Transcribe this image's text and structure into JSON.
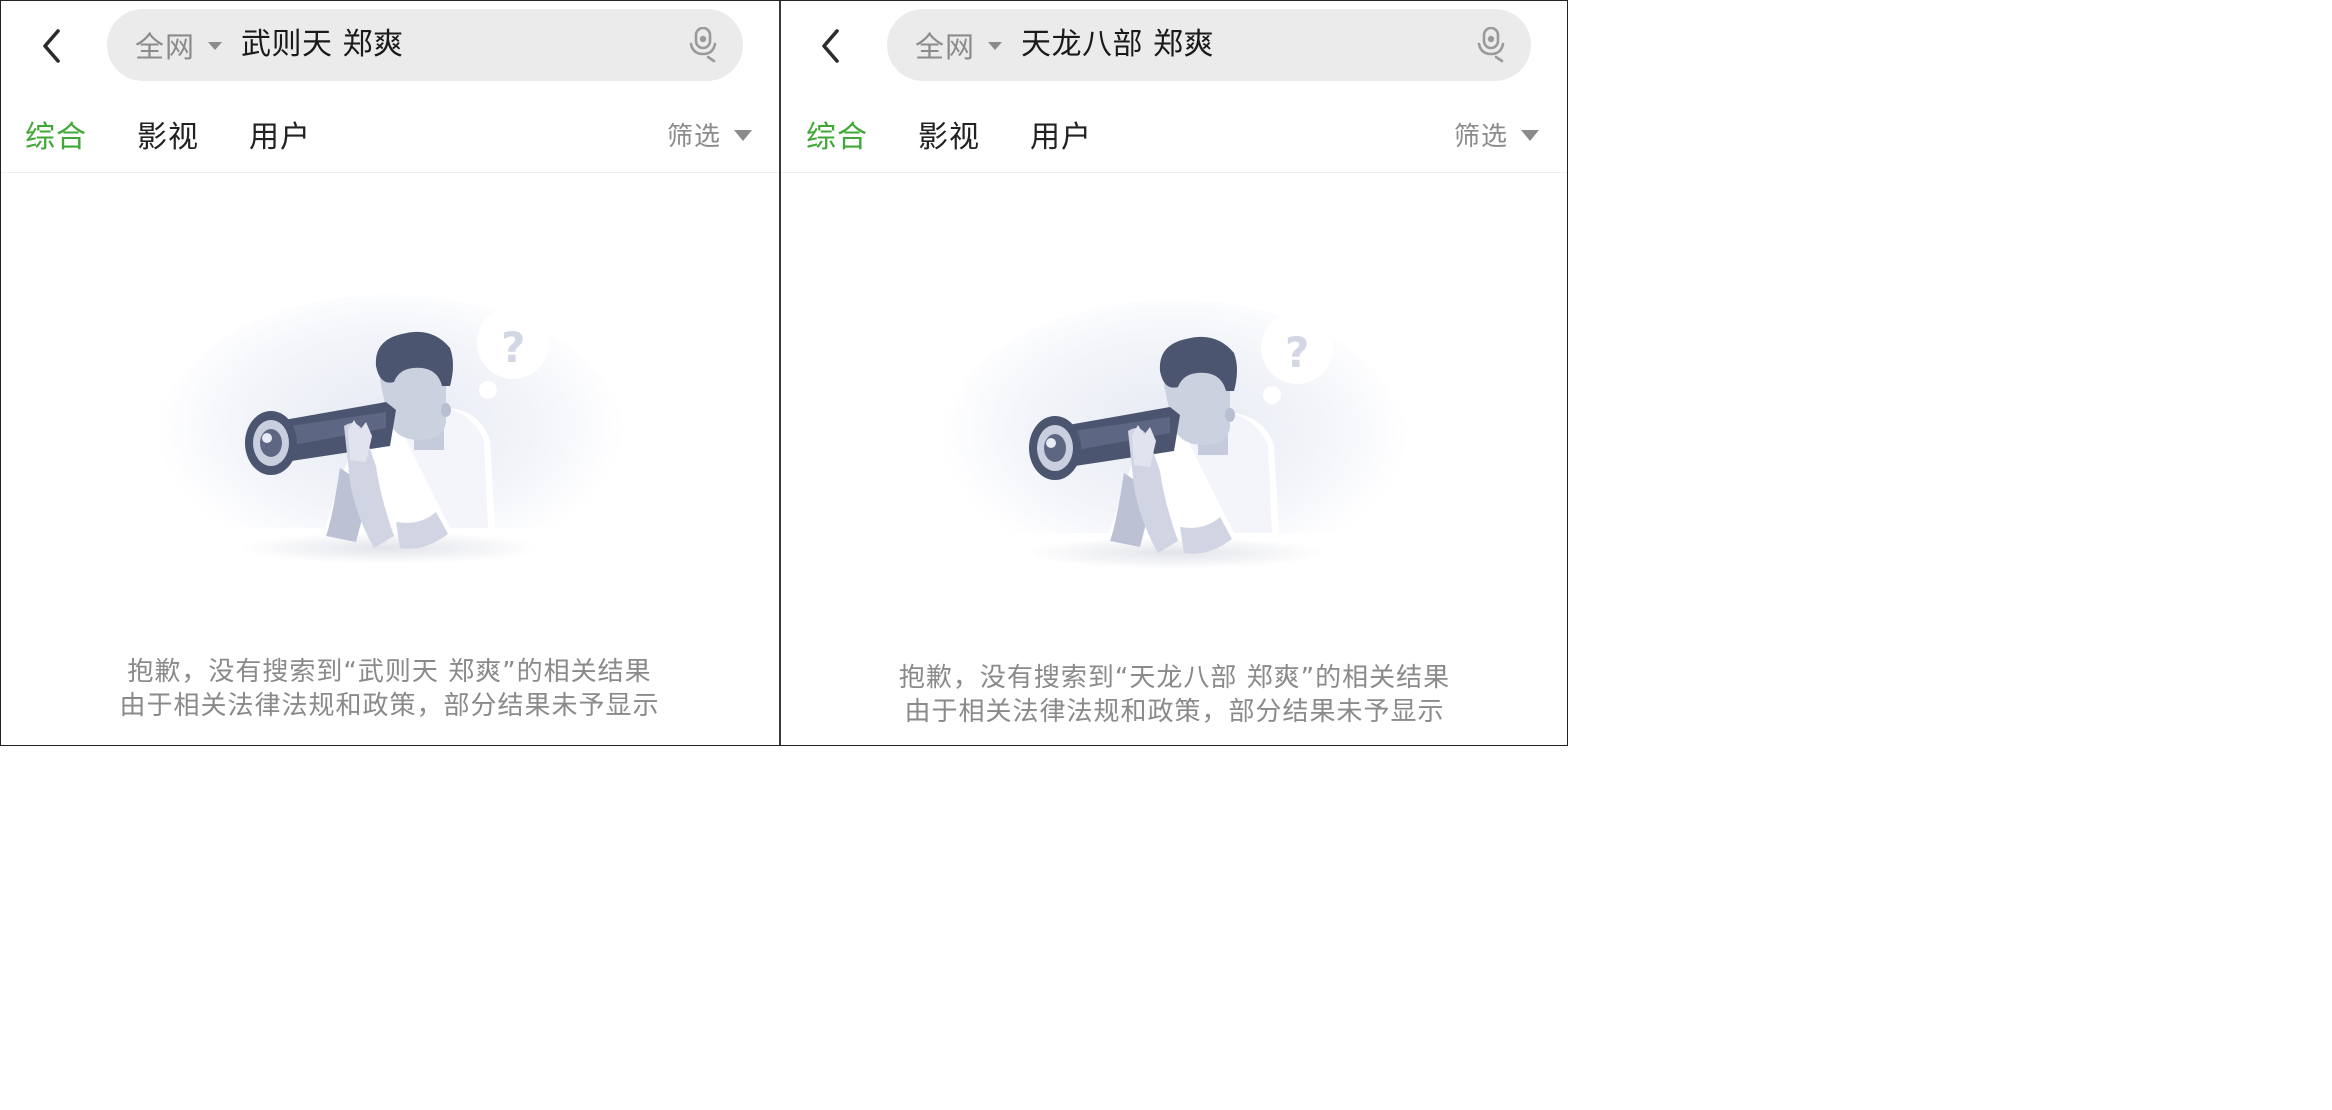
{
  "colors": {
    "accent_green": "#3fa835",
    "search_bg": "#ebebeb",
    "muted_text": "#8a8a8a",
    "illustration_navy": "#4b5570"
  },
  "panels": [
    {
      "search": {
        "scope": "全网",
        "query": "武则天 郑爽",
        "scope_icon": "caret-down-icon",
        "voice_icon": "microphone-icon"
      },
      "tabs": [
        {
          "label": "综合",
          "active": true
        },
        {
          "label": "影视"
        },
        {
          "label": "用户"
        }
      ],
      "filter": {
        "label": "筛选",
        "icon": "caret-down-icon"
      },
      "empty_state": {
        "icon": "telescope-search-illustration",
        "line1": "抱歉，没有搜索到“武则天 郑爽”的相关结果",
        "line2": "由于相关法律法规和政策，部分结果未予显示"
      }
    },
    {
      "search": {
        "scope": "全网",
        "query": "天龙八部 郑爽",
        "scope_icon": "caret-down-icon",
        "voice_icon": "microphone-icon"
      },
      "tabs": [
        {
          "label": "综合",
          "active": true
        },
        {
          "label": "影视"
        },
        {
          "label": "用户"
        }
      ],
      "filter": {
        "label": "筛选",
        "icon": "caret-down-icon"
      },
      "empty_state": {
        "icon": "telescope-search-illustration",
        "line1": "抱歉，没有搜索到“天龙八部 郑爽”的相关结果",
        "line2": "由于相关法律法规和政策，部分结果未予显示"
      }
    }
  ]
}
